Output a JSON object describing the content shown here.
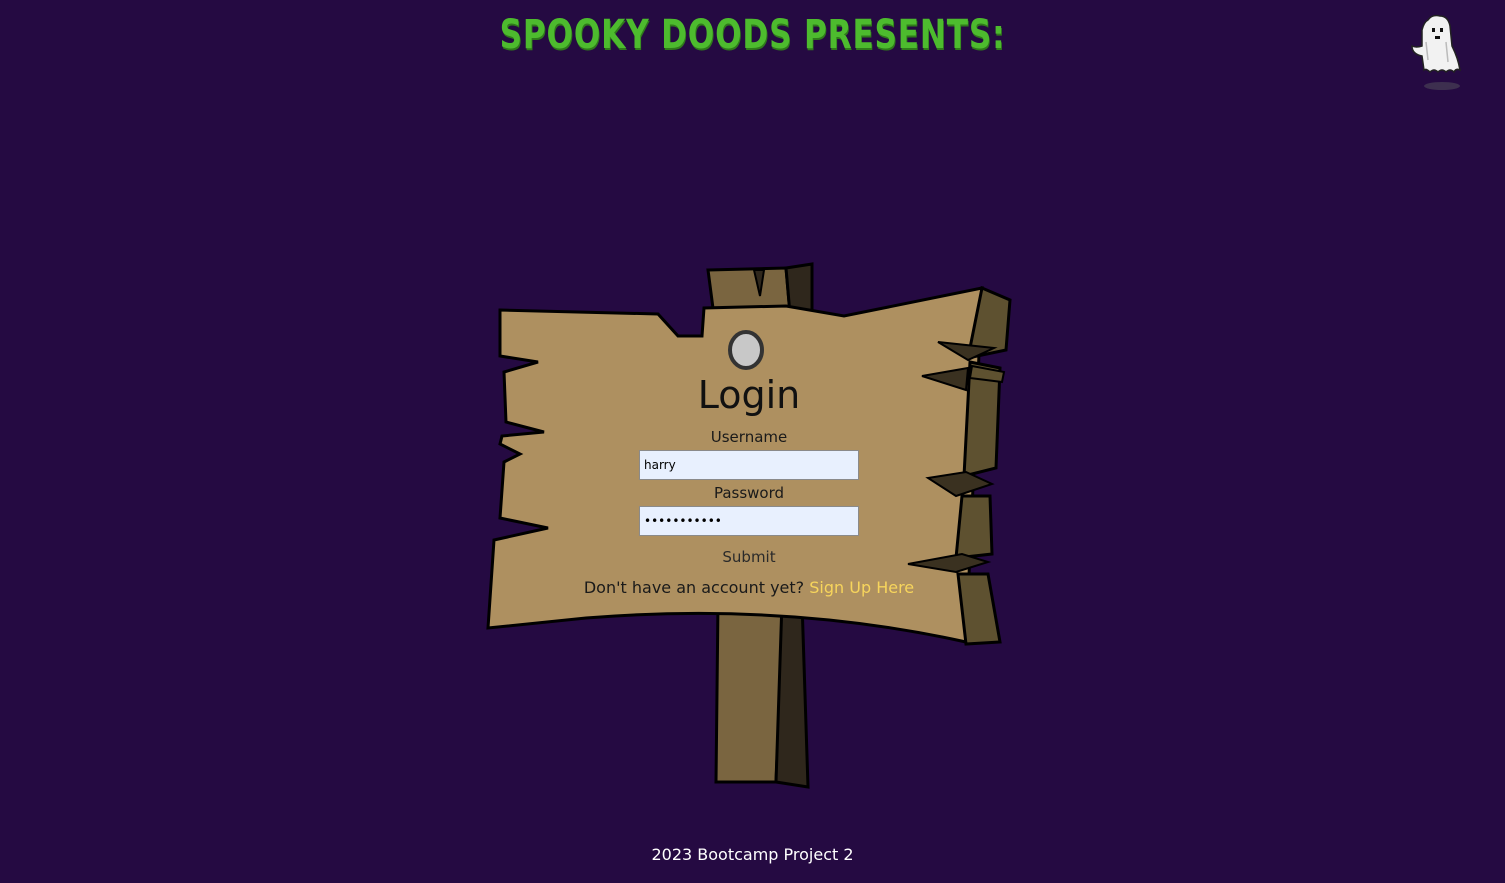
{
  "header": {
    "title": "SPOOKY DOODS PRESENTS:",
    "ghost_icon": "ghost-icon"
  },
  "login": {
    "title": "Login",
    "username_label": "Username",
    "username_value": "harry",
    "password_label": "Password",
    "password_value": "•••••••••••",
    "submit_label": "Submit",
    "signup_prompt": "Don't have an account yet?",
    "signup_link": "Sign Up Here"
  },
  "footer": {
    "text": "2023 Bootcamp Project 2"
  },
  "colors": {
    "background": "#250a42",
    "title": "#4dbb2e",
    "sign": "#ae9060",
    "link": "#f7d55c"
  }
}
